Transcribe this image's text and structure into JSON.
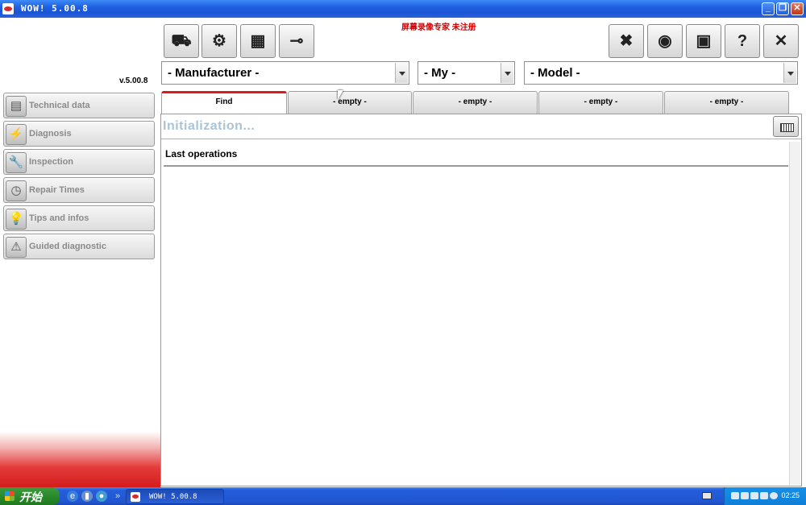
{
  "window": {
    "title": "WOW! 5.00.8",
    "buttons": [
      "minimize",
      "restore",
      "close"
    ]
  },
  "version": "v.5.00.8",
  "watermark": "屏幕录像专家 未注册",
  "toolbar_left": [
    {
      "name": "vehicle-list-button",
      "icon": "car-stack-icon",
      "glyph": "⛟"
    },
    {
      "name": "engine-button",
      "icon": "engine-icon",
      "glyph": "⚙"
    },
    {
      "name": "battery-button",
      "icon": "battery-icon",
      "glyph": "▦"
    },
    {
      "name": "connector-button",
      "icon": "connector-icon",
      "glyph": "⊸"
    }
  ],
  "toolbar_right": [
    {
      "name": "settings-tools-button",
      "icon": "tools-icon",
      "glyph": "✖"
    },
    {
      "name": "vci-button",
      "icon": "vci-signal-icon",
      "glyph": "◉"
    },
    {
      "name": "package-button",
      "icon": "package-icon",
      "glyph": "▣"
    },
    {
      "name": "help-button",
      "icon": "question-icon",
      "glyph": "?"
    },
    {
      "name": "exit-button",
      "icon": "close-icon",
      "glyph": "✕"
    }
  ],
  "selectors": {
    "manufacturer": "- Manufacturer -",
    "my": "- My -",
    "model": "- Model -"
  },
  "sidebar": {
    "items": [
      {
        "label": "Technical data",
        "icon": "technical-data-icon",
        "glyph": "▤"
      },
      {
        "label": "Diagnosis",
        "icon": "diagnosis-icon",
        "glyph": "⚡"
      },
      {
        "label": "Inspection",
        "icon": "wrench-icon",
        "glyph": "🔧"
      },
      {
        "label": "Repair Times",
        "icon": "clock-icon",
        "glyph": "◷"
      },
      {
        "label": "Tips and infos",
        "icon": "lightbulb-icon",
        "glyph": "💡"
      },
      {
        "label": "Guided diagnostic",
        "icon": "guided-diagnostic-icon",
        "glyph": "⚠"
      }
    ]
  },
  "tabs": [
    "Find",
    "- empty -",
    "- empty -",
    "- empty -",
    "- empty -"
  ],
  "main": {
    "status": "Initialization...",
    "section_title": "Last operations"
  },
  "taskbar": {
    "start_label": "开始",
    "task_label": "WOW! 5.00.8",
    "clock": "02:25"
  }
}
